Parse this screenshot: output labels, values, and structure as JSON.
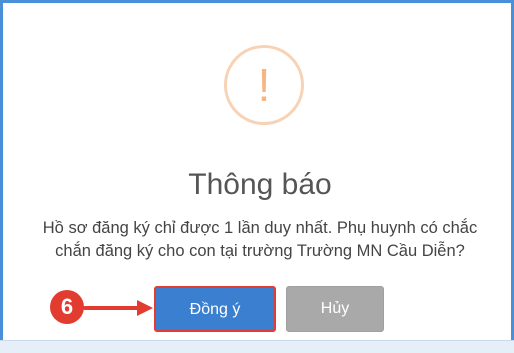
{
  "dialog": {
    "title": "Thông báo",
    "message_line1": "Hồ sơ đăng ký chỉ được 1 lần duy nhất. Phụ huynh có chắc",
    "message_line2": "chắn đăng ký cho con tại trường Trường MN Cầu Diễn?",
    "alert_symbol": "!",
    "confirm_label": "Đồng ý",
    "cancel_label": "Hủy"
  },
  "annotation": {
    "step_number": "6"
  },
  "colors": {
    "frame_border": "#4a90d9",
    "alert_ring": "#f8d2b4",
    "alert_mark": "#f6b682",
    "confirm_button": "#3a7fd0",
    "cancel_button": "#a9a9a9",
    "annotation_red": "#e23b2f"
  },
  "icons": {
    "alert": "exclamation-circle-icon",
    "pointer": "arrow-right-icon"
  }
}
